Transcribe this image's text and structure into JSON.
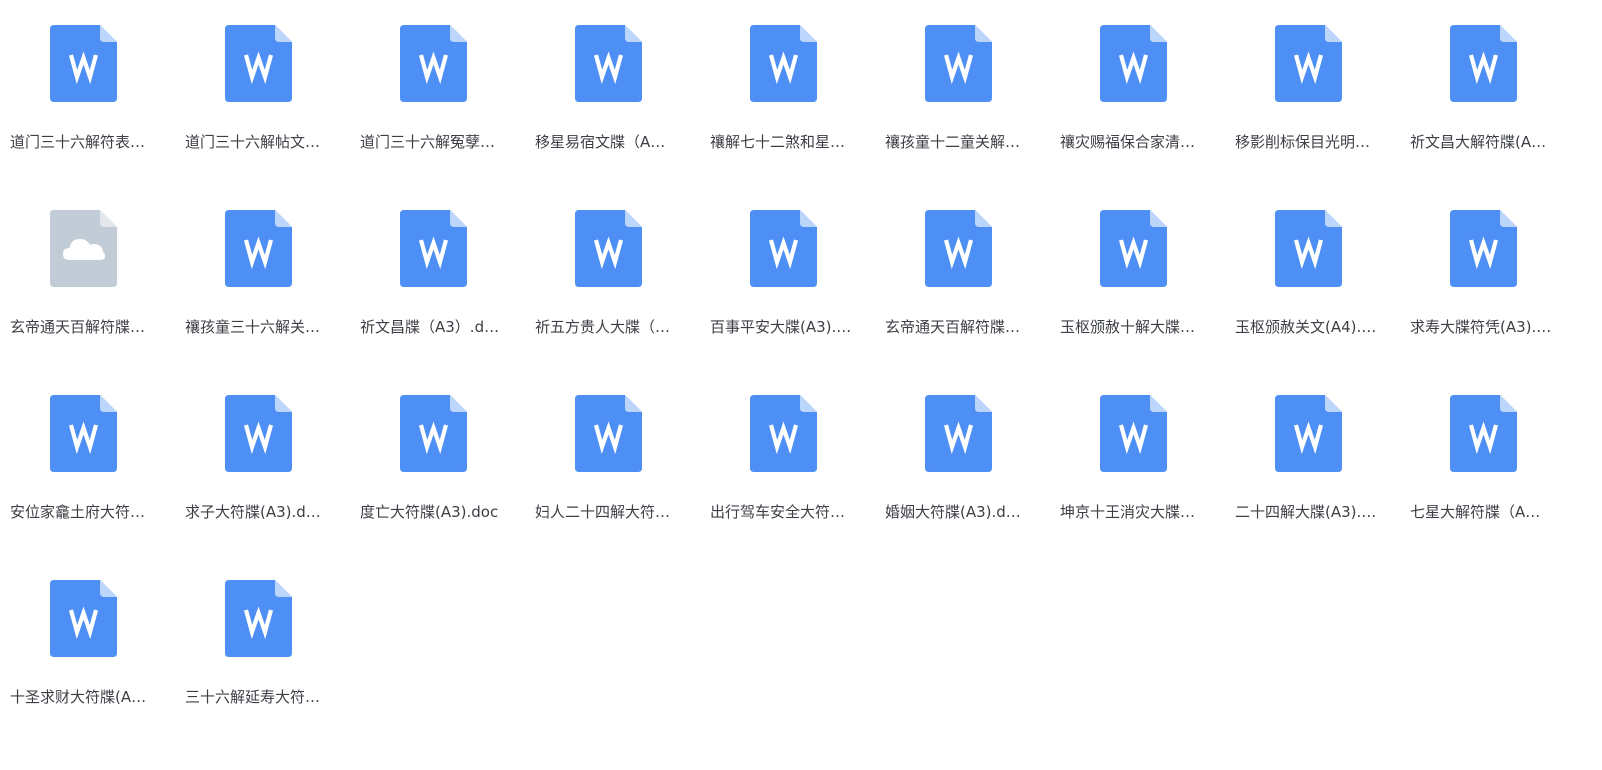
{
  "colors": {
    "word_icon": "#4d8ff5",
    "word_fold": "#bcd5fb",
    "cloud_icon": "#c2ccd6",
    "cloud_fold": "#e1e7ed",
    "text": "#3c3f45"
  },
  "files": [
    {
      "name": "道门三十六解符表…",
      "icon": "word-document-icon"
    },
    {
      "name": "道门三十六解帖文…",
      "icon": "word-document-icon"
    },
    {
      "name": "道门三十六解冤孽…",
      "icon": "word-document-icon"
    },
    {
      "name": "移星易宿文牒（A…",
      "icon": "word-document-icon"
    },
    {
      "name": "禳解七十二煞和星…",
      "icon": "word-document-icon"
    },
    {
      "name": "禳孩童十二童关解…",
      "icon": "word-document-icon"
    },
    {
      "name": "禳灾赐福保合家清…",
      "icon": "word-document-icon"
    },
    {
      "name": "移影削标保目光明…",
      "icon": "word-document-icon"
    },
    {
      "name": "祈文昌大解符牒(A…",
      "icon": "word-document-icon"
    },
    {
      "name": "玄帝通天百解符牒…",
      "icon": "cloud-file-icon"
    },
    {
      "name": "禳孩童三十六解关…",
      "icon": "word-document-icon"
    },
    {
      "name": "祈文昌牒（A3）.d…",
      "icon": "word-document-icon"
    },
    {
      "name": "祈五方贵人大牒（…",
      "icon": "word-document-icon"
    },
    {
      "name": "百事平安大牒(A3).…",
      "icon": "word-document-icon"
    },
    {
      "name": "玄帝通天百解符牒…",
      "icon": "word-document-icon"
    },
    {
      "name": "玉枢颁赦十解大牒…",
      "icon": "word-document-icon"
    },
    {
      "name": "玉枢颁赦关文(A4).…",
      "icon": "word-document-icon"
    },
    {
      "name": "求寿大牒符凭(A3).…",
      "icon": "word-document-icon"
    },
    {
      "name": "安位家龕土府大符…",
      "icon": "word-document-icon"
    },
    {
      "name": "求子大符牒(A3).d…",
      "icon": "word-document-icon"
    },
    {
      "name": " 度亡大符牒(A3).doc",
      "icon": "word-document-icon"
    },
    {
      "name": "妇人二十四解大符…",
      "icon": "word-document-icon"
    },
    {
      "name": "出行驾车安全大符…",
      "icon": "word-document-icon"
    },
    {
      "name": "婚姻大符牒(A3).d…",
      "icon": "word-document-icon"
    },
    {
      "name": "坤京十王消灾大牒…",
      "icon": "word-document-icon"
    },
    {
      "name": "二十四解大牒(A3).…",
      "icon": "word-document-icon"
    },
    {
      "name": "七星大解符牒（A…",
      "icon": "word-document-icon"
    },
    {
      "name": "十圣求财大符牒(A…",
      "icon": "word-document-icon"
    },
    {
      "name": "三十六解延寿大符…",
      "icon": "word-document-icon"
    }
  ]
}
